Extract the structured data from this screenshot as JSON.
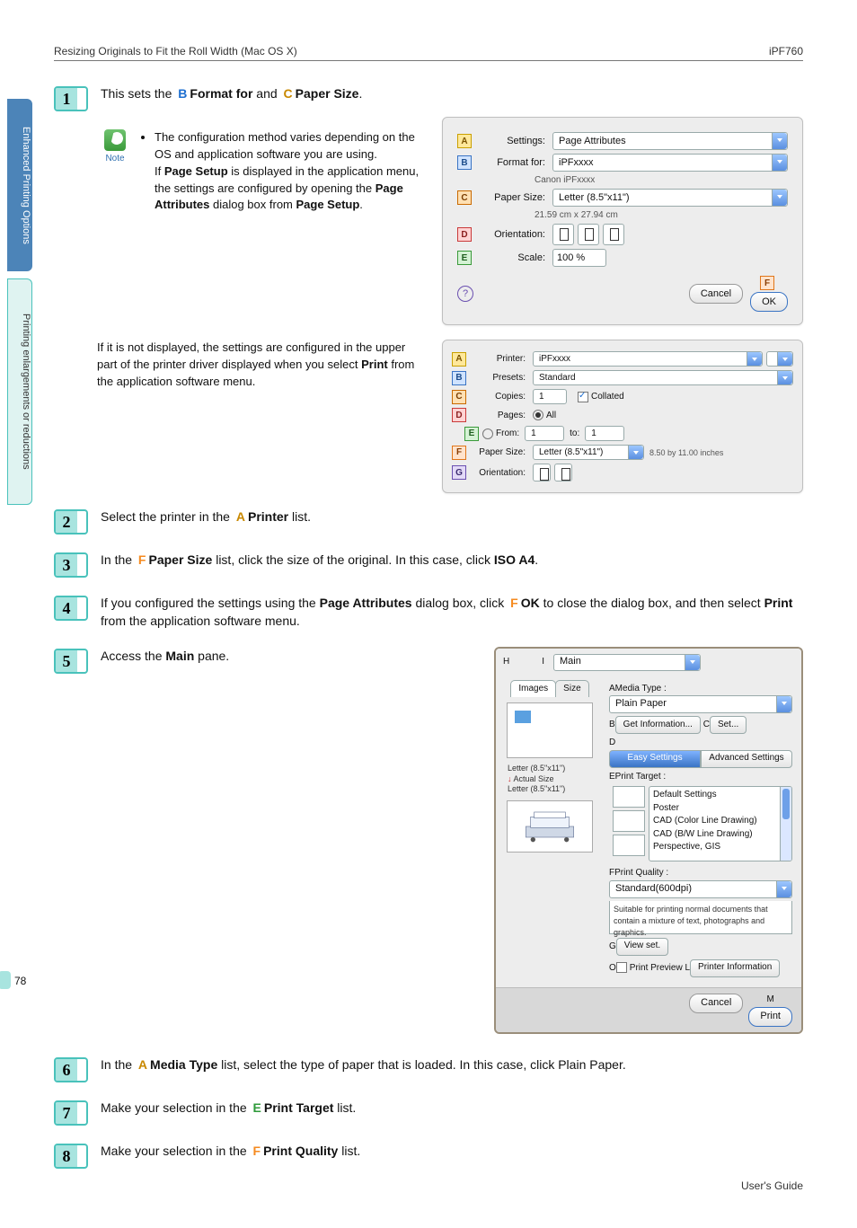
{
  "header": {
    "left": "Resizing Originals to Fit the Roll Width (Mac OS X)",
    "right": "iPF760"
  },
  "sidebar": {
    "tab1": "Enhanced Printing Options",
    "tab2": "Printing enlargements or reductions"
  },
  "page_number": "78",
  "footer": "User's Guide",
  "markers": {
    "A": "A",
    "B": "B",
    "C": "C",
    "D": "D",
    "E": "E",
    "F": "F",
    "G": "G",
    "H": "H",
    "I": "I",
    "L": "L",
    "M": "M",
    "O": "O"
  },
  "step1": {
    "num": "1",
    "t1": "This sets the ",
    "t2": "Format for",
    "t3": " and ",
    "t4": "Paper Size",
    "t5": "."
  },
  "note": {
    "label": "Note",
    "l1": "The configuration method varies depending on the OS and application software you are using.",
    "l2a": "If ",
    "l2b": "Page Setup",
    "l2c": " is displayed in the application menu, the settings are configured by opening the ",
    "l2d": "Page Attributes",
    "l2e": " dialog box from ",
    "l2f": "Page Setup",
    "l2g": "."
  },
  "fig1": {
    "settings_l": "Settings:",
    "settings_v": "Page Attributes",
    "format_l": "Format for:",
    "format_v": "iPFxxxx",
    "format_sub": "Canon iPFxxxx",
    "paper_l": "Paper Size:",
    "paper_v": "Letter (8.5\"x11\")",
    "paper_sub": "21.59 cm x 27.94 cm",
    "orient_l": "Orientation:",
    "scale_l": "Scale:",
    "scale_v": "100 %",
    "cancel": "Cancel",
    "ok": "OK"
  },
  "mid": {
    "t1": "If it is not displayed, the settings are configured in the upper part of the printer driver displayed when you select ",
    "t2": "Print",
    "t3": " from the application software menu."
  },
  "fig2": {
    "printer_l": "Printer:",
    "printer_v": "iPFxxxx",
    "presets_l": "Presets:",
    "presets_v": "Standard",
    "copies_l": "Copies:",
    "copies_v": "1",
    "collated": "Collated",
    "pages_l": "Pages:",
    "all": "All",
    "from": "From:",
    "from_v": "1",
    "to": "to:",
    "to_v": "1",
    "paper_l": "Paper Size:",
    "paper_v": "Letter (8.5\"x11\")",
    "paper_sub": "8.50 by 11.00 inches",
    "orient_l": "Orientation:"
  },
  "step2": {
    "num": "2",
    "t1": "Select the printer in the ",
    "t2": "Printer",
    "t3": " list."
  },
  "step3": {
    "num": "3",
    "t1": "In the ",
    "t2": "Paper Size",
    "t3": " list, click the size of the original. In this case, click ",
    "t4": "ISO A4",
    "t5": "."
  },
  "step4": {
    "num": "4",
    "t1": "If you configured the settings using the ",
    "t2": "Page Attributes",
    "t3": " dialog box, click ",
    "t4": "OK",
    "t5": " to close the dialog box, and then select ",
    "t6": "Print",
    "t7": " from the application software menu."
  },
  "step5": {
    "num": "5",
    "t1": "Access the ",
    "t2": "Main",
    "t3": " pane."
  },
  "fig3": {
    "top_sel": "Main",
    "tabs": {
      "images": "Images",
      "size": "Size"
    },
    "media_l": "Media Type :",
    "media_v": "Plain Paper",
    "getinfo": "Get Information...",
    "set": "Set...",
    "easy": "Easy Settings",
    "adv": "Advanced Settings",
    "target_l": "Print Target :",
    "targets": [
      "Default Settings",
      "Poster",
      "CAD (Color Line Drawing)",
      "CAD (B/W Line Drawing)",
      "Perspective, GIS"
    ],
    "quality_l": "Print Quality :",
    "quality_v": "Standard(600dpi)",
    "hint": "Suitable for printing normal documents that contain a mixture of text, photographs and graphics.",
    "viewset": "View set.",
    "preview": "Print Preview",
    "pinfo": "Printer Information",
    "left": {
      "l1": "Letter (8.5\"x11\")",
      "l2": "Actual Size",
      "l3": "Letter (8.5\"x11\")"
    },
    "cancel": "Cancel",
    "print": "Print"
  },
  "step6": {
    "num": "6",
    "t1": "In the ",
    "t2": "Media Type",
    "t3": " list, select the type of paper that is loaded. In this case, click Plain Paper."
  },
  "step7": {
    "num": "7",
    "t1": "Make your selection in the ",
    "t2": "Print Target",
    "t3": " list."
  },
  "step8": {
    "num": "8",
    "t1": "Make your selection in the ",
    "t2": "Print Quality",
    "t3": " list."
  }
}
